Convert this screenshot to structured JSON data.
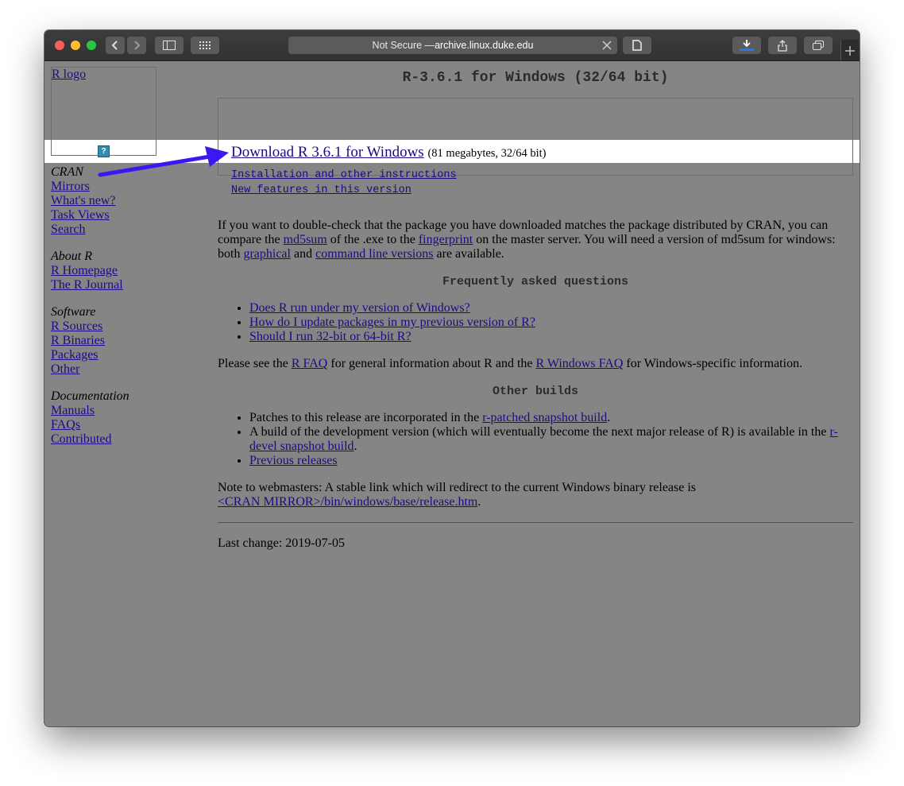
{
  "browser": {
    "url_prefix": "Not Secure — ",
    "url_host": "archive.linux.duke.edu"
  },
  "sidebar": {
    "logo_alt": "R logo",
    "sections": [
      {
        "heading": "CRAN",
        "links": [
          "Mirrors",
          "What's new?",
          "Task Views",
          "Search"
        ]
      },
      {
        "heading": "About R",
        "links": [
          "R Homepage",
          "The R Journal"
        ]
      },
      {
        "heading": "Software",
        "links": [
          "R Sources",
          "R Binaries",
          "Packages",
          "Other"
        ]
      },
      {
        "heading": "Documentation",
        "links": [
          "Manuals",
          "FAQs",
          "Contributed"
        ]
      }
    ]
  },
  "main": {
    "title": "R-3.6.1 for Windows (32/64 bit)",
    "download_link": "Download R 3.6.1 for Windows",
    "download_size": "(81 megabytes, 32/64 bit)",
    "install_link": "Installation and other instructions",
    "features_link": "New features in this version",
    "md5": {
      "t1": "If you want to double-check that the package you have downloaded matches the package distributed by CRAN, you can compare the ",
      "l1": "md5sum",
      "t2": " of the .exe to the ",
      "l2": "fingerprint",
      "t3": " on the master server. You will need a version of md5sum for windows: both ",
      "l3": "graphical",
      "t4": " and ",
      "l4": "command line versions",
      "t5": " are available."
    },
    "faq_heading": "Frequently asked questions",
    "faq_items": [
      "Does R run under my version of Windows?",
      "How do I update packages in my previous version of R?",
      "Should I run 32-bit or 64-bit R?"
    ],
    "faq_note": {
      "t1": "Please see the ",
      "l1": "R FAQ",
      "t2": " for general information about R and the ",
      "l2": "R Windows FAQ",
      "t3": " for Windows-specific information."
    },
    "builds_heading": "Other builds",
    "builds": {
      "b1_text": "Patches to this release are incorporated in the ",
      "b1_link": "r-patched snapshot build",
      "b1_end": ".",
      "b2_text": "A build of the development version (which will eventually become the next major release of R) is available in the ",
      "b2_link": "r-devel snapshot build",
      "b2_end": ".",
      "b3_link": "Previous releases"
    },
    "webmaster": {
      "text": "Note to webmasters: A stable link which will redirect to the current Windows binary release is",
      "link": "<CRAN MIRROR>/bin/windows/base/release.htm",
      "end": "."
    },
    "last_change": "Last change: 2019-07-05"
  },
  "colors": {
    "link": "#1d0a84",
    "annotation_arrow": "#3a18f0",
    "page_dimmed": "#858585"
  }
}
